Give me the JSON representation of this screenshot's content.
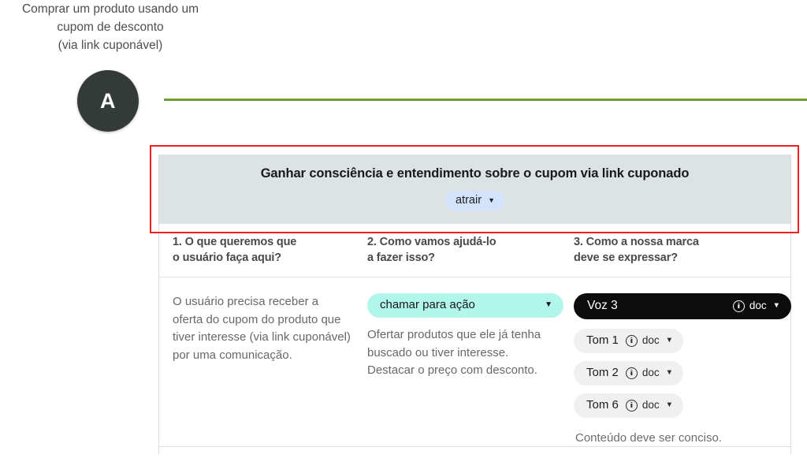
{
  "journey": {
    "caption": "Comprar um produto usando um\ncupom de desconto\n(via link cuponável)",
    "stage_letter": "A"
  },
  "colors": {
    "accent_rule": "#6f9b33",
    "highlight_border": "#ef1f1f",
    "card_header_bg": "#dde3e4",
    "stage_chip_bg": "#d2e3fb",
    "action_chip_bg": "#b2f5ea",
    "voice_pill_bg": "#0c0c0c",
    "tone_pill_bg": "#f0f0f0",
    "badge_bg": "#343a38"
  },
  "card": {
    "header": {
      "title": "Ganhar consciência e entendimento sobre o cupom via link cuponado",
      "stage_chip_label": "atrair",
      "stage_chip_caret": "▼"
    },
    "columns": [
      {
        "heading": "1. O que queremos que\no usuário faça aqui?"
      },
      {
        "heading": "2. Como vamos ajudá-lo\na fazer isso?"
      },
      {
        "heading": "3. Como a nossa marca\ndeve se expressar?"
      }
    ],
    "column1": {
      "body": "O usuário precisa receber a oferta do cupom do produto que tiver interesse (via link cuponável) por uma comunicação."
    },
    "column2": {
      "action_chip_label": "chamar para ação",
      "action_chip_caret": "▼",
      "body": "Ofertar produtos que ele já tenha buscado ou tiver interesse. Destacar o preço com desconto."
    },
    "column3": {
      "voice": {
        "label": "Voz 3",
        "doc_label": "doc",
        "caret": "▼"
      },
      "tones": [
        {
          "label": "Tom 1",
          "doc_label": "doc",
          "caret": "▼"
        },
        {
          "label": "Tom 2",
          "doc_label": "doc",
          "caret": "▼"
        },
        {
          "label": "Tom 6",
          "doc_label": "doc",
          "caret": "▼"
        }
      ],
      "note": "Conteúdo deve ser conciso."
    }
  }
}
